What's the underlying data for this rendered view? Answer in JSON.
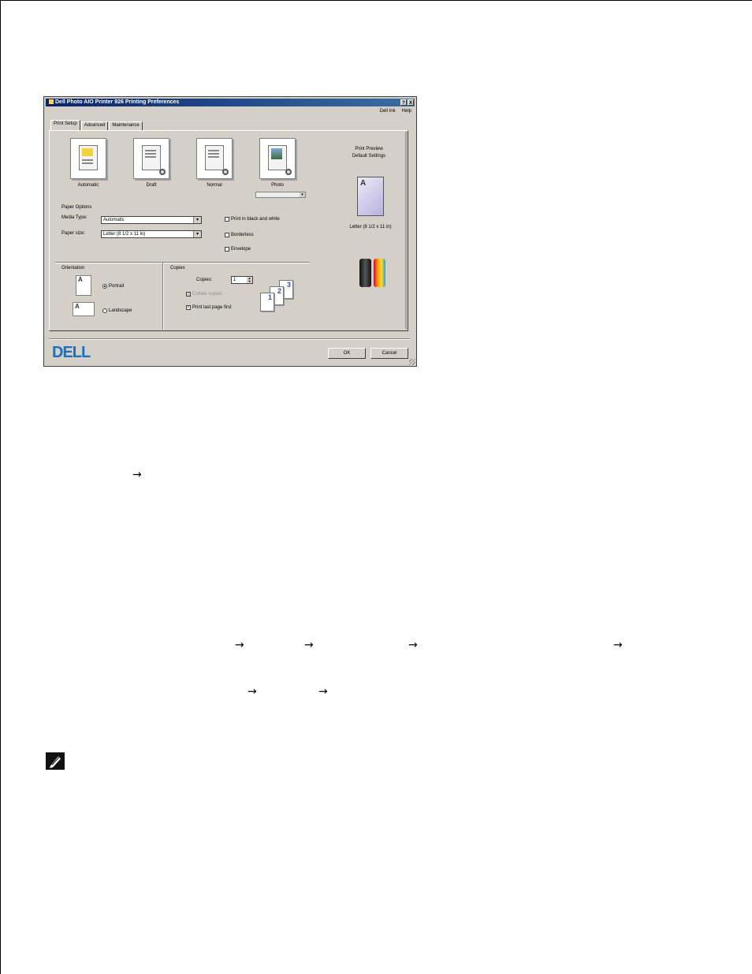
{
  "dialog": {
    "title": "Dell Photo AIO Printer 926 Printing Preferences",
    "title_buttons": [
      "?",
      "X"
    ],
    "menu_links": [
      "Dell Ink",
      "Help"
    ],
    "tabs": [
      "Print Setup",
      "Advanced",
      "Maintenance"
    ],
    "quality_options": [
      "Automatic",
      "Draft",
      "Normal",
      "Photo"
    ],
    "photo_select_value": "",
    "paper_options_label": "Paper Options",
    "media_type_label": "Media Type:",
    "media_type_value": "Automatic",
    "paper_size_label": "Paper size:",
    "paper_size_value": "Letter (8 1/2 x 11 in)",
    "checkboxes": [
      "Print in black and white",
      "Borderless",
      "Envelope"
    ],
    "orientation_label": "Orientation",
    "orientation_options": [
      "Portrait",
      "Landscape"
    ],
    "copies_group_label": "Copies",
    "copies_label": "Copies:",
    "copies_value": "1",
    "collate_label": "Collate copies",
    "print_last_first_label": "Print last page first",
    "right_links": [
      "Print Preview",
      "Default Settings"
    ],
    "preview_letter": "A",
    "preview_label": "Letter (8 1/2 x 11 in)",
    "logo": "DELL",
    "ok_label": "OK",
    "cancel_label": "Cancel"
  },
  "page": {
    "arrow": "→"
  }
}
